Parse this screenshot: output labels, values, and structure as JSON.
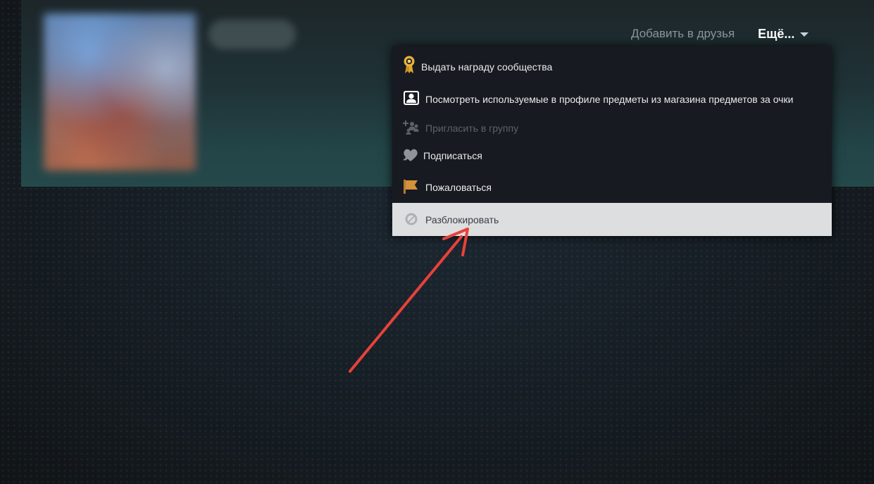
{
  "profile": {
    "add_friend_label": "Добавить в друзья",
    "more_label": "Ещё..."
  },
  "dropdown": {
    "items": [
      {
        "label": "Выдать награду сообщества",
        "icon": "award-ribbon-icon",
        "state": "normal"
      },
      {
        "label": "Посмотреть используемые в профиле предметы из магазина предметов за очки",
        "icon": "profile-items-icon",
        "state": "normal"
      },
      {
        "label": "Пригласить в группу",
        "icon": "invite-group-icon",
        "state": "disabled"
      },
      {
        "label": "Подписаться",
        "icon": "heart-follow-icon",
        "state": "normal"
      },
      {
        "label": "Пожаловаться",
        "icon": "flag-icon",
        "state": "normal"
      },
      {
        "label": "Разблокировать",
        "icon": "unblock-icon",
        "state": "hovered"
      }
    ]
  },
  "colors": {
    "menu_background": "#171a21",
    "menu_text": "#ebebeb",
    "menu_disabled_text": "#5d6268",
    "menu_hover_background": "#dcdedf",
    "award_gold": "#e8b33a",
    "flag_orange": "#d4923a",
    "annotation_arrow": "#e8413b"
  }
}
